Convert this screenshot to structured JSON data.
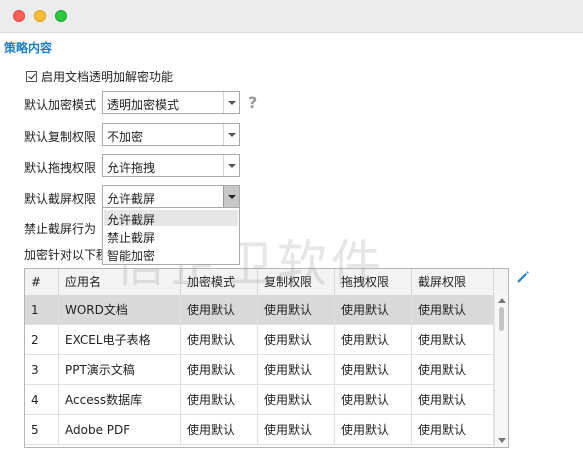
{
  "window": {
    "controls": [
      "close",
      "minimize",
      "maximize"
    ]
  },
  "section_title": "策略内容",
  "enable_checkbox": {
    "label": "启用文档透明加解密功能",
    "checked": true
  },
  "settings": {
    "encrypt_mode": {
      "label": "默认加密模式",
      "value": "透明加密模式"
    },
    "copy_perm": {
      "label": "默认复制权限",
      "value": "不加密"
    },
    "drag_perm": {
      "label": "默认拖拽权限",
      "value": "允许拖拽"
    },
    "screenshot_perm": {
      "label": "默认截屏权限",
      "value": "允许截屏"
    }
  },
  "help_icon": "?",
  "dropdown": {
    "options": [
      "允许截屏",
      "禁止截屏",
      "智能加密"
    ],
    "selected_index": 0
  },
  "behind_labels": {
    "ban_screenshot": "禁止截屏行为",
    "encrypt_targets": "加密针对以下程"
  },
  "table": {
    "headers": [
      "#",
      "应用名",
      "加密模式",
      "复制权限",
      "拖拽权限",
      "截屏权限"
    ],
    "rows": [
      [
        "1",
        "WORD文档",
        "使用默认",
        "使用默认",
        "使用默认",
        "使用默认"
      ],
      [
        "2",
        "EXCEL电子表格",
        "使用默认",
        "使用默认",
        "使用默认",
        "使用默认"
      ],
      [
        "3",
        "PPT演示文稿",
        "使用默认",
        "使用默认",
        "使用默认",
        "使用默认"
      ],
      [
        "4",
        "Access数据库",
        "使用默认",
        "使用默认",
        "使用默认",
        "使用默认"
      ],
      [
        "5",
        "Adobe PDF",
        "使用默认",
        "使用默认",
        "使用默认",
        "使用默认"
      ]
    ],
    "selected_row": 0
  },
  "watermark": "信企卫软件",
  "colors": {
    "accent": "#1a7fc8",
    "selected_row": "#d9d9d9",
    "edit_icon": "#1a7fc8"
  }
}
